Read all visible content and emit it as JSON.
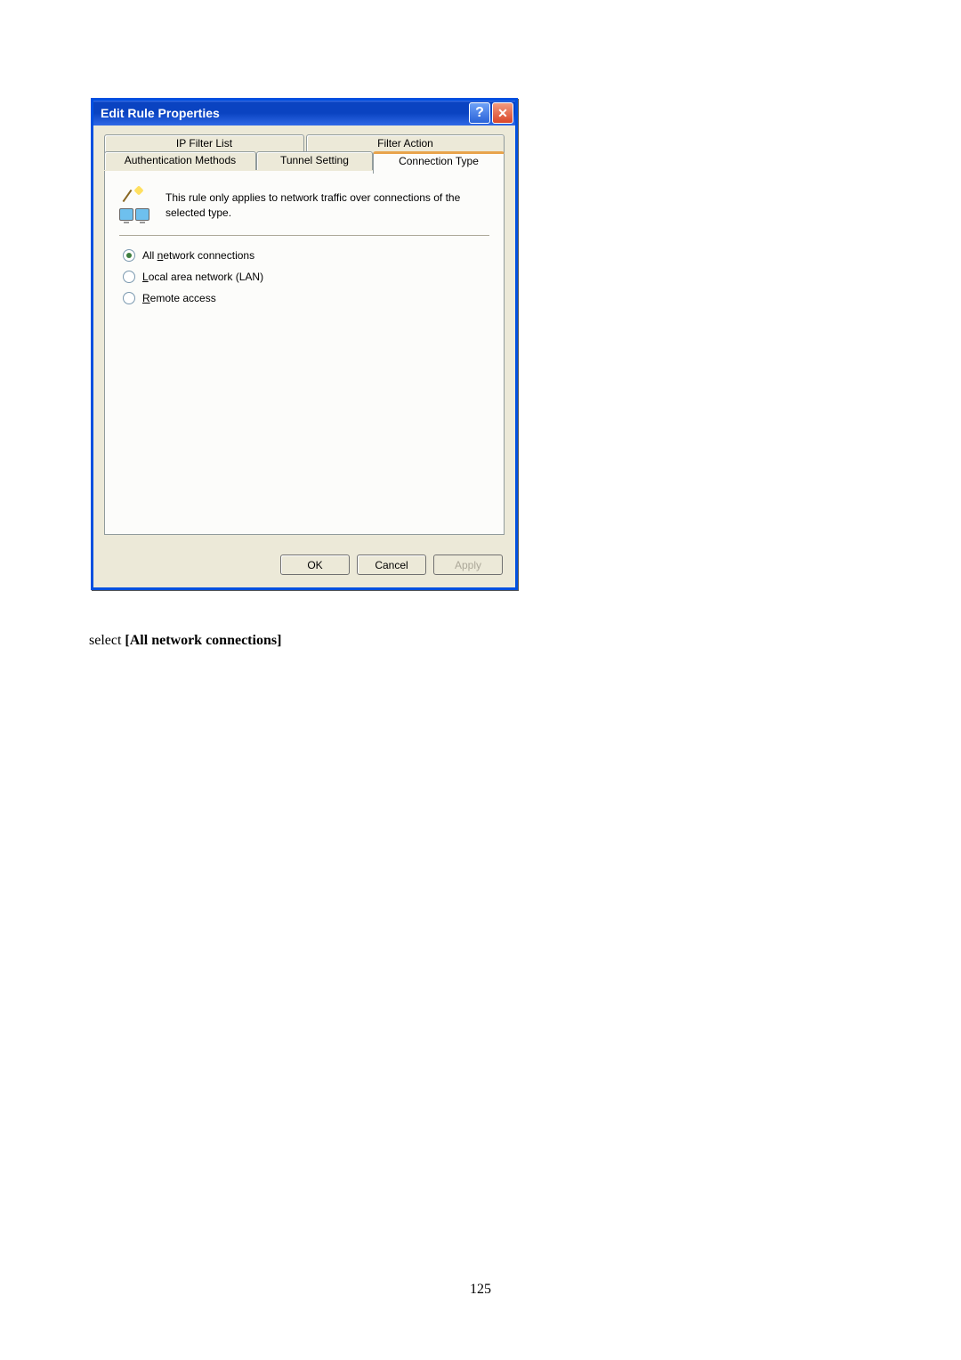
{
  "dialog": {
    "title": "Edit Rule Properties",
    "tabs": {
      "ip_filter_list": "IP Filter List",
      "filter_action": "Filter Action",
      "auth_methods": "Authentication Methods",
      "tunnel_setting": "Tunnel Setting",
      "connection_type": "Connection Type"
    },
    "description": "This rule only applies to network traffic over connections of the selected type.",
    "radios": {
      "all": {
        "prefix": "All ",
        "u": "n",
        "suffix": "etwork connections"
      },
      "lan": {
        "prefix": "",
        "u": "L",
        "suffix": "ocal area network (LAN)"
      },
      "remote": {
        "prefix": "",
        "u": "R",
        "suffix": "emote access"
      }
    },
    "buttons": {
      "ok": "OK",
      "cancel": "Cancel",
      "apply": "Apply"
    }
  },
  "instruction": {
    "prefix": "select ",
    "bold": "[All network connections]"
  },
  "page_number": "125"
}
